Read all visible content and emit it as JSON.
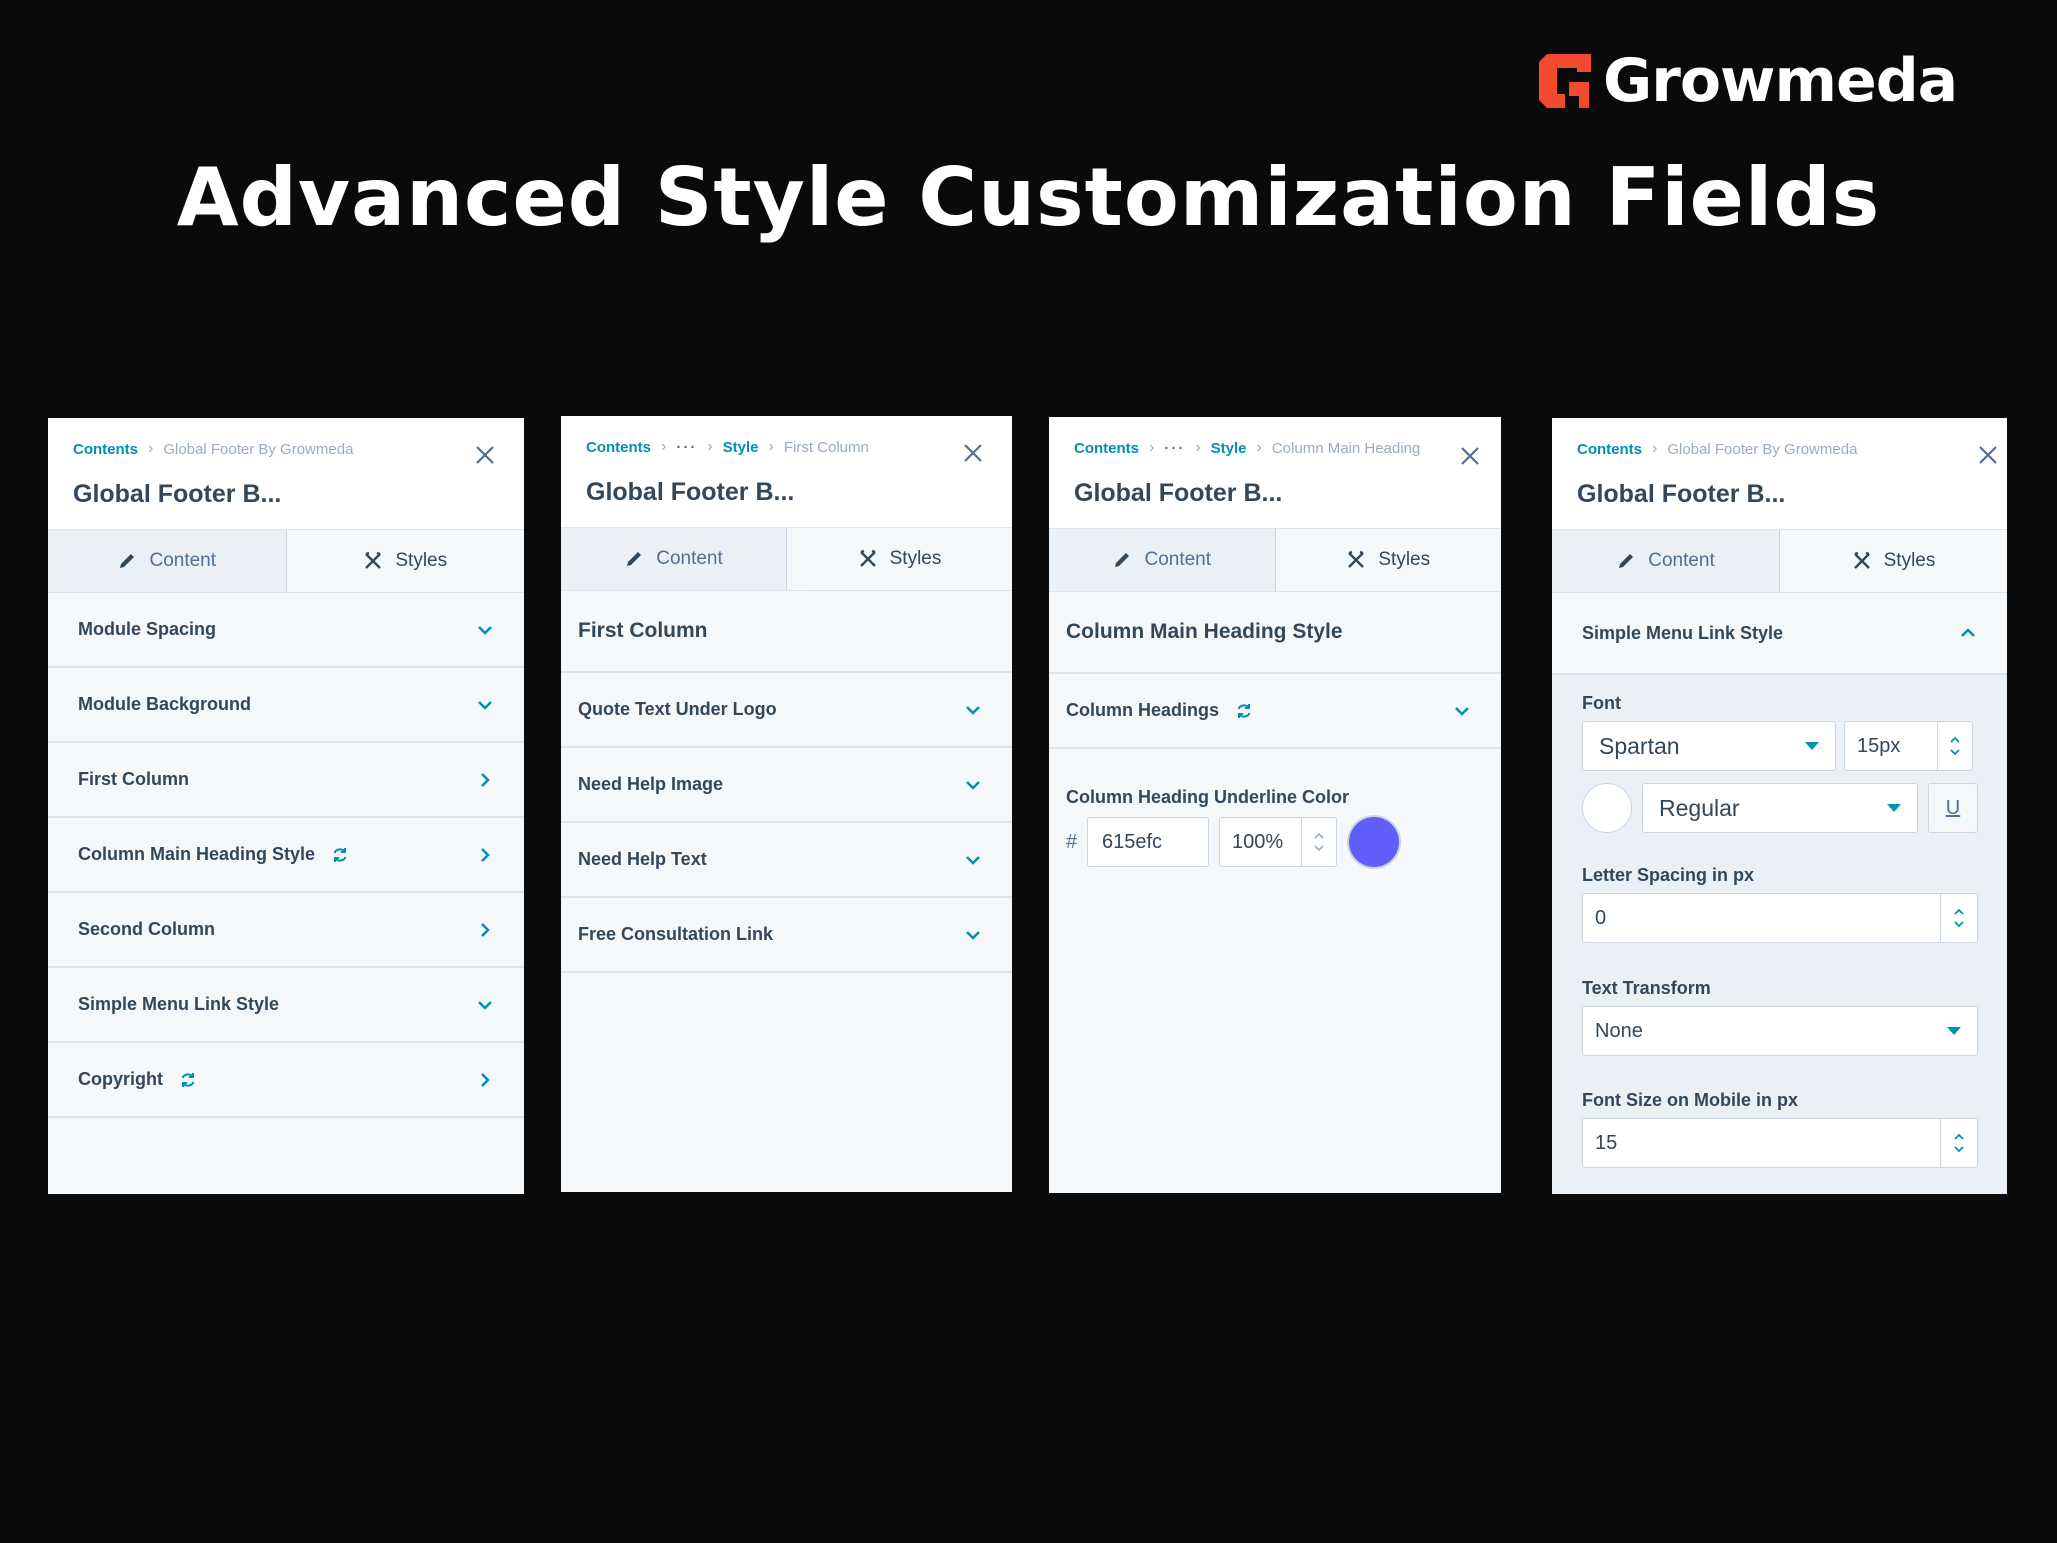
{
  "brand": {
    "name": "Growmeda",
    "accent": "#f2492f"
  },
  "headline": "Advanced Style Customization Fields",
  "colors": {
    "link": "#0091ae",
    "text": "#33475b",
    "swatch": "#615efc"
  },
  "panel1": {
    "crumb_root": "Contents",
    "crumb_current": "Global Footer By Growmeda",
    "title": "Global Footer B...",
    "tabs": {
      "content": "Content",
      "styles": "Styles"
    },
    "rows": [
      {
        "label": "Module Spacing",
        "icon": "chevron-down"
      },
      {
        "label": "Module Background",
        "icon": "chevron-down"
      },
      {
        "label": "First Column",
        "icon": "chevron-right"
      },
      {
        "label": "Column Main Heading Style",
        "icon": "chevron-right",
        "sync": true
      },
      {
        "label": "Second Column",
        "icon": "chevron-right"
      },
      {
        "label": "Simple Menu Link Style",
        "icon": "chevron-down"
      },
      {
        "label": "Copyright",
        "icon": "chevron-right",
        "sync": true
      }
    ]
  },
  "panel2": {
    "crumb_root": "Contents",
    "crumb_dots": "···",
    "crumb_mid": "Style",
    "crumb_current": "First Column",
    "title": "Global Footer B...",
    "tabs": {
      "content": "Content",
      "styles": "Styles"
    },
    "section": "First Column",
    "rows": [
      {
        "label": "Quote Text Under Logo"
      },
      {
        "label": "Need Help Image"
      },
      {
        "label": "Need Help Text"
      },
      {
        "label": "Free Consultation Link"
      }
    ]
  },
  "panel3": {
    "crumb_root": "Contents",
    "crumb_dots": "···",
    "crumb_mid": "Style",
    "crumb_current": "Column Main Heading",
    "title": "Global Footer B...",
    "tabs": {
      "content": "Content",
      "styles": "Styles"
    },
    "section": "Column Main Heading Style",
    "group": "Column Headings",
    "field_label": "Column Heading Underline Color",
    "hash": "#",
    "hex": "615efc",
    "opacity": "100%"
  },
  "panel4": {
    "crumb_root": "Contents",
    "crumb_current": "Global Footer By Growmeda",
    "title": "Global Footer B...",
    "tabs": {
      "content": "Content",
      "styles": "Styles"
    },
    "section": "Simple Menu Link Style",
    "font_label": "Font",
    "font_family": "Spartan",
    "font_size": "15px",
    "font_weight": "Regular",
    "underline": "U",
    "letter_spacing_label": "Letter Spacing in px",
    "letter_spacing": "0",
    "transform_label": "Text Transform",
    "transform": "None",
    "mobile_size_label": "Font Size on Mobile in px",
    "mobile_size": "15"
  }
}
